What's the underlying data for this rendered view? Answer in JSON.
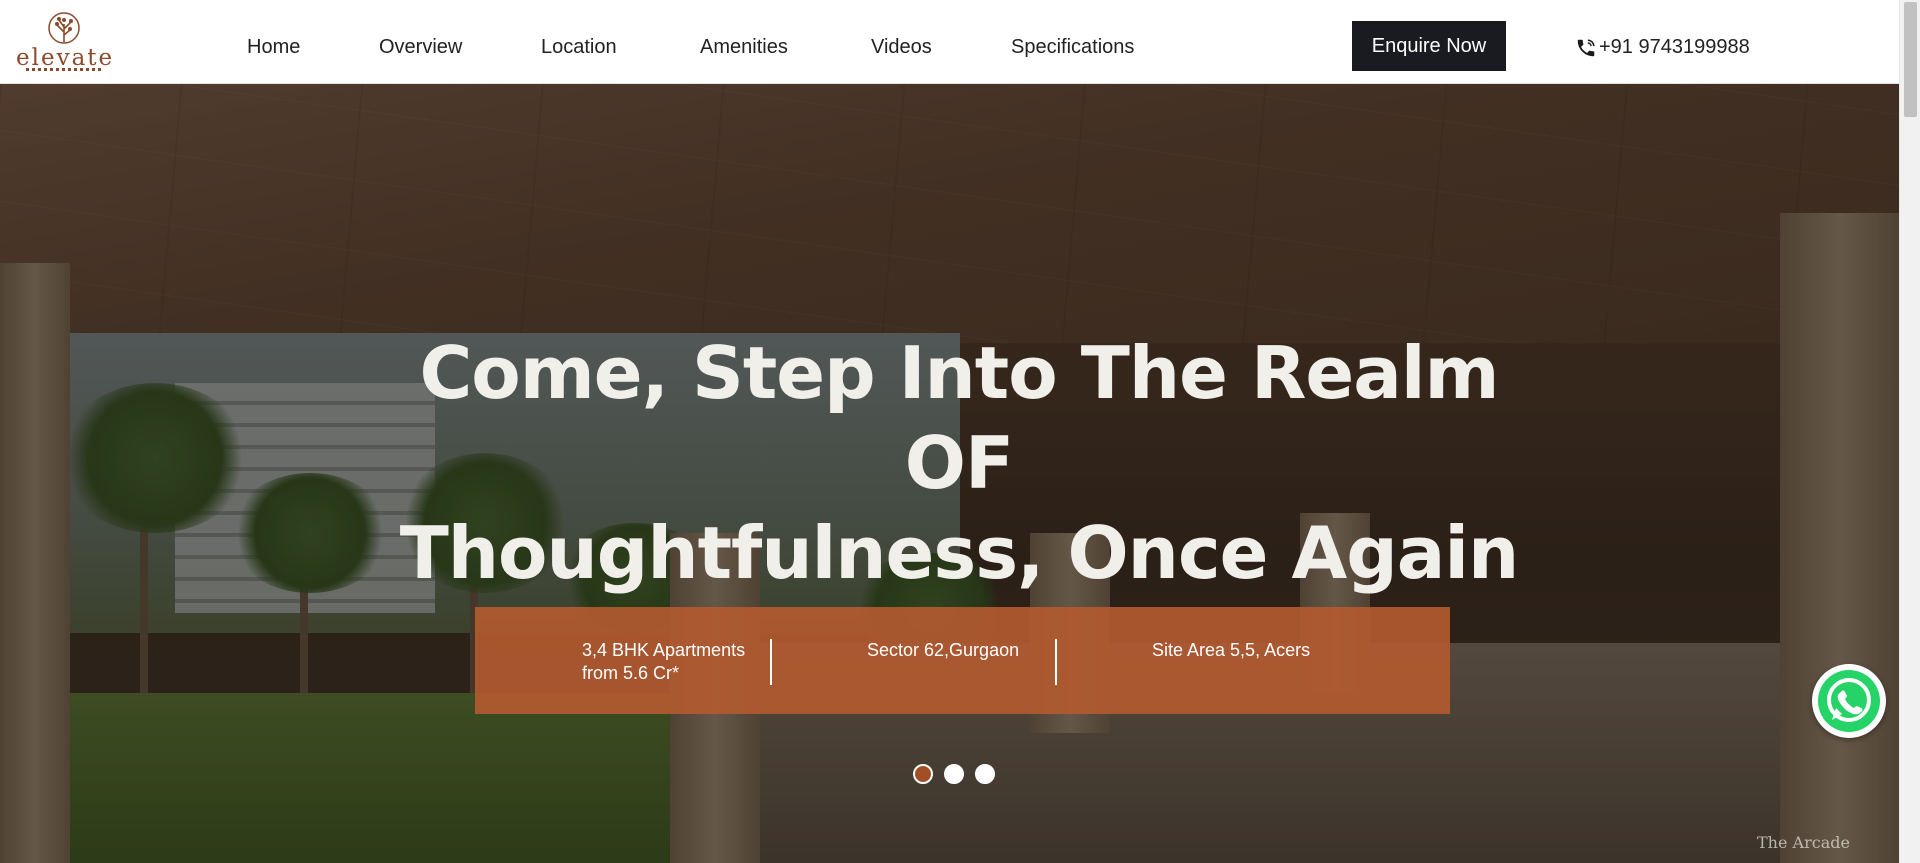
{
  "brand": {
    "name": "elevate",
    "tagline": "ENRICHED LIVING",
    "color": "#8a4a2b"
  },
  "nav": {
    "items": [
      {
        "label": "Home"
      },
      {
        "label": "Overview"
      },
      {
        "label": "Location"
      },
      {
        "label": "Amenities"
      },
      {
        "label": "Videos"
      },
      {
        "label": "Specifications"
      }
    ]
  },
  "header": {
    "enquire_label": "Enquire Now",
    "phone": "+91 9743199988",
    "phone_icon": "phone-icon"
  },
  "hero": {
    "title_line1": "Come, Step Into The Realm OF",
    "title_line2": "Thoughtfulness, Once Again",
    "info": [
      {
        "line1": "3,4 BHK Apartments",
        "line2": "from 5.6 Cr*"
      },
      {
        "line1": "Sector 62,Gurgaon",
        "line2": ""
      },
      {
        "line1": "Site Area 5,5, Acers",
        "line2": ""
      }
    ],
    "slider_dots": 3,
    "active_dot": 1,
    "image_caption": "The Arcade",
    "accent_color": "#b25a30"
  },
  "whatsapp": {
    "icon": "whatsapp-icon",
    "color": "#25d366"
  }
}
